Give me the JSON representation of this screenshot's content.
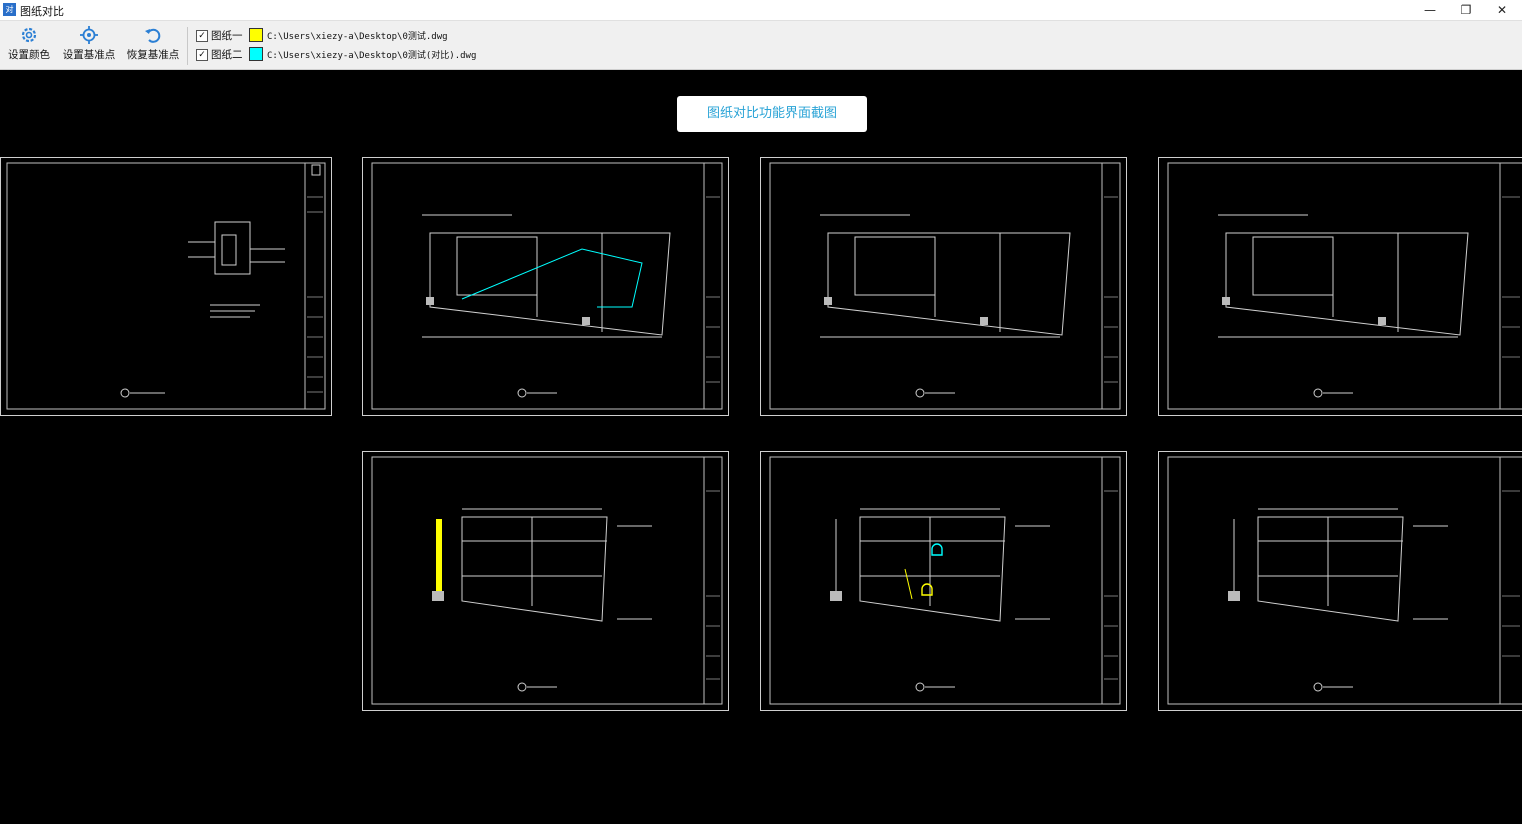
{
  "window": {
    "title": "图纸对比",
    "app_icon_text": "对",
    "minimize": "—",
    "restore": "❐",
    "close": "✕"
  },
  "toolbar": {
    "set_color_label": "设置颜色",
    "set_base_label": "设置基准点",
    "restore_base_label": "恢复基准点"
  },
  "drawings": [
    {
      "label": "图纸一",
      "checked": true,
      "color": "#ffff00",
      "path": "C:\\Users\\xiezy-a\\Desktop\\0测试.dwg"
    },
    {
      "label": "图纸二",
      "checked": true,
      "color": "#00ffff",
      "path": "C:\\Users\\xiezy-a\\Desktop\\0测试(对比).dwg"
    }
  ],
  "caption": "图纸对比功能界面截图",
  "colors": {
    "line": "#d8d8d8",
    "wall": "#bdbdbd",
    "highlight_a": "#ffff00",
    "highlight_b": "#00ffff"
  }
}
